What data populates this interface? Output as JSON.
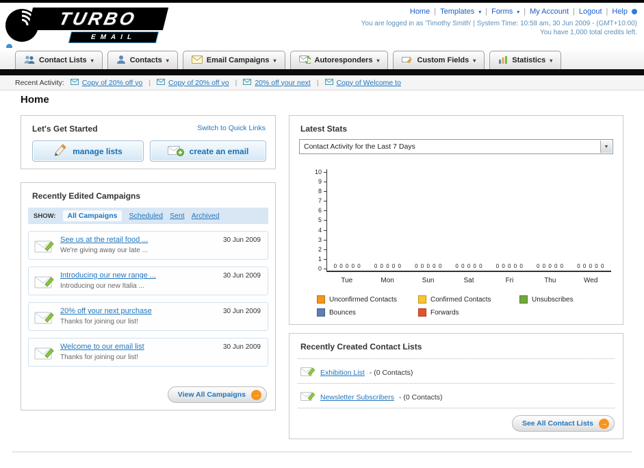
{
  "header": {
    "logo": {
      "primary": "TURBO",
      "secondary": "EMAIL"
    },
    "nav_links": [
      {
        "label": "Home",
        "dropdown": false
      },
      {
        "label": "Templates",
        "dropdown": true
      },
      {
        "label": "Forms",
        "dropdown": true
      },
      {
        "label": "My Account",
        "dropdown": false
      },
      {
        "label": "Logout",
        "dropdown": false
      },
      {
        "label": "Help",
        "dropdown": false
      }
    ],
    "session_info": "You are logged in as 'Timothy Smith' | System Time: 10:58 am, 30 Jun 2009 - (GMT+10:00)",
    "credits_info": "You have 1,000 total credits left."
  },
  "main_nav": {
    "items": [
      {
        "label": "Contact Lists",
        "icon": "contact-lists-icon"
      },
      {
        "label": "Contacts",
        "icon": "contacts-icon"
      },
      {
        "label": "Email Campaigns",
        "icon": "email-campaigns-icon"
      },
      {
        "label": "Autoresponders",
        "icon": "autoresponders-icon"
      },
      {
        "label": "Custom Fields",
        "icon": "custom-fields-icon"
      },
      {
        "label": "Statistics",
        "icon": "statistics-icon"
      }
    ]
  },
  "recent_activity": {
    "label": "Recent Activity:",
    "items": [
      "Copy of 20% off yo",
      "Copy of 20% off yo",
      "20% off your next",
      "Copy of Welcome to"
    ]
  },
  "page": {
    "title": "Home"
  },
  "get_started": {
    "title": "Let's Get Started",
    "switch_link": "Switch to Quick Links",
    "manage_lists_label": "manage lists",
    "create_email_label": "create an email"
  },
  "campaigns": {
    "title": "Recently Edited Campaigns",
    "show_label": "SHOW:",
    "filters": [
      "All Campaigns",
      "Scheduled",
      "Sent",
      "Archived"
    ],
    "items": [
      {
        "title": "See us at the retail food ...",
        "subtitle": "We're giving away our late ...",
        "date": "30 Jun 2009"
      },
      {
        "title": "Introducing our new range ...",
        "subtitle": "Introducing our new Italia ...",
        "date": "30 Jun 2009"
      },
      {
        "title": "20% off your next purchase",
        "subtitle": "Thanks for joining our list!",
        "date": "30 Jun 2009"
      },
      {
        "title": "Welcome to our email list",
        "subtitle": "Thanks for joining our list!",
        "date": "30 Jun 2009"
      }
    ],
    "view_all_label": "View All Campaigns"
  },
  "stats": {
    "title": "Latest Stats",
    "selected_option": "Contact Activity for the Last 7 Days"
  },
  "chart_data": {
    "type": "bar",
    "title": "Contact Activity for the Last 7 Days",
    "categories": [
      "Tue",
      "Mon",
      "Sun",
      "Sat",
      "Fri",
      "Thu",
      "Wed"
    ],
    "series": [
      {
        "name": "Unconfirmed Contacts",
        "color": "#f5941e",
        "values": [
          0,
          0,
          0,
          0,
          0,
          0,
          0
        ]
      },
      {
        "name": "Confirmed Contacts",
        "color": "#fdc32f",
        "values": [
          0,
          0,
          0,
          0,
          0,
          0,
          0
        ]
      },
      {
        "name": "Unsubscribes",
        "color": "#71a83c",
        "values": [
          0,
          0,
          0,
          0,
          0,
          0,
          0
        ]
      },
      {
        "name": "Bounces",
        "color": "#5c7fb4",
        "values": [
          0,
          0,
          0,
          0,
          0,
          0,
          0
        ]
      },
      {
        "name": "Forwards",
        "color": "#e65229",
        "values": [
          0,
          0,
          0,
          0,
          0,
          0,
          0
        ]
      }
    ],
    "ylim": [
      0,
      10
    ],
    "grid": false,
    "legend_position": "bottom"
  },
  "contact_lists": {
    "title": "Recently Created Contact Lists",
    "items": [
      {
        "name": "Exhibition List",
        "suffix": "- (0 Contacts)"
      },
      {
        "name": "Newsletter Subscribers",
        "suffix": "- (0 Contacts)"
      }
    ],
    "see_all_label": "See All Contact Lists"
  },
  "colors": {
    "link_blue": "#2176bd",
    "accent_orange": "#f7941d",
    "nav_bar_black": "#0b0b0b"
  }
}
